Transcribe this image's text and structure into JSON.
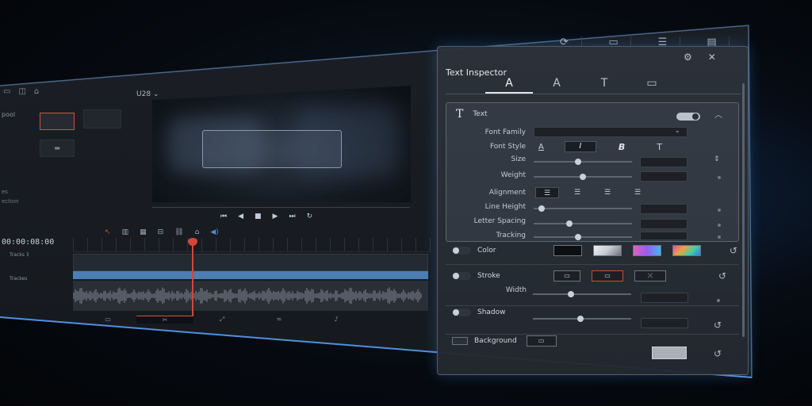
{
  "window": {
    "top_icons": [
      "sync-icon",
      "monitor-icon",
      "sliders-icon",
      "panel-icon"
    ]
  },
  "media": {
    "pool_label": "pool",
    "side_labels": [
      "es",
      "ection"
    ]
  },
  "viewer": {
    "resolution": "U28"
  },
  "timeline": {
    "timecode": "00:00:08:00",
    "tracks": [
      "Tracks 3",
      "Trackes"
    ]
  },
  "inspector": {
    "title": "Text Inspector",
    "tabs": [
      "A",
      "A",
      "T",
      "▭"
    ],
    "text_section": {
      "label": "Text",
      "font_family_label": "Font Family",
      "font_style_label": "Font Style",
      "size_label": "Size",
      "weight_label": "Weight",
      "alignment_label": "Alignment",
      "line_height_label": "Line Height",
      "letter_spacing_label": "Letter Spacing",
      "tracking_label": "Tracking",
      "font_styles": [
        "A",
        "I",
        "B",
        "T"
      ],
      "levels": {
        "size": 0.45,
        "weight": 0.5,
        "line_height": 0.05,
        "letter_spacing": 0.35,
        "tracking": 0.45
      }
    },
    "color_label": "Color",
    "stroke_label": "Stroke",
    "width_label": "Width",
    "shadow_label": "Shadow",
    "background_label": "Background",
    "swatch_colors": [
      "#0d0f12",
      "#c7ccd2",
      "#9a5cf0",
      "#e24ab3"
    ]
  }
}
